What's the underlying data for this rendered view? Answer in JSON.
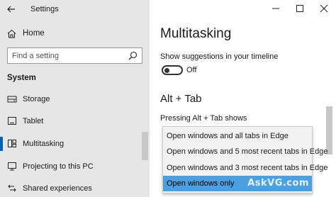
{
  "window": {
    "app_title": "Settings",
    "controls": [
      "minimize-icon",
      "maximize-icon",
      "close-icon"
    ]
  },
  "sidebar": {
    "home_label": "Home",
    "search_placeholder": "Find a setting",
    "section_header": "System",
    "items": [
      {
        "label": "Storage",
        "icon": "storage-icon",
        "selected": false
      },
      {
        "label": "Tablet",
        "icon": "tablet-icon",
        "selected": false
      },
      {
        "label": "Multitasking",
        "icon": "multitasking-icon",
        "selected": true
      },
      {
        "label": "Projecting to this PC",
        "icon": "projecting-icon",
        "selected": false
      },
      {
        "label": "Shared experiences",
        "icon": "shared-experiences-icon",
        "selected": false
      }
    ]
  },
  "main": {
    "page_title": "Multitasking",
    "timeline_label": "Show suggestions in your timeline",
    "timeline_toggle": "Off",
    "alt_tab_header": "Alt + Tab",
    "pressing_label": "Pressing Alt + Tab shows",
    "dropdown_options": [
      {
        "label": "Open windows and all tabs in Edge",
        "selected": false
      },
      {
        "label": "Open windows and 5 most recent tabs in Edge",
        "selected": false
      },
      {
        "label": "Open windows and 3 most recent tabs in Edge",
        "selected": false
      },
      {
        "label": "Open windows only",
        "selected": true
      }
    ]
  },
  "watermark": "AskVG.com",
  "colors": {
    "sidebar_bg": "#e6e6e6",
    "accent": "#0063b1",
    "selected_option": "#4ca0e0"
  }
}
